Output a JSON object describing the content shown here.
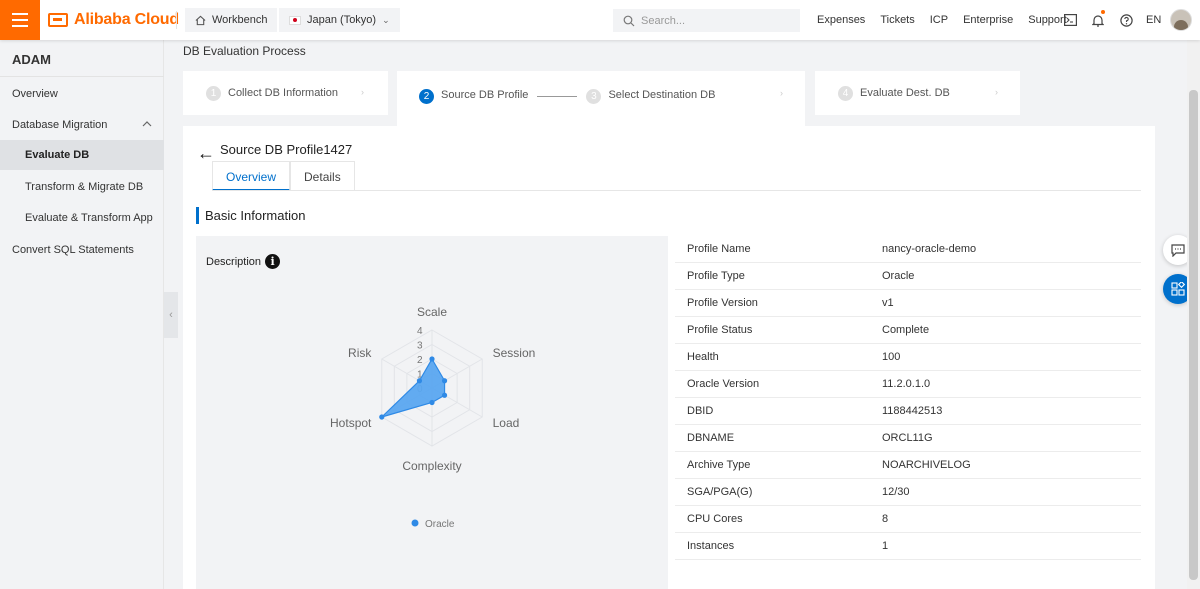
{
  "topbar": {
    "logo_text": "Alibaba Cloud",
    "workbench_label": "Workbench",
    "region_label": "Japan (Tokyo)",
    "search_placeholder": "Search...",
    "links": [
      "Expenses",
      "Tickets",
      "ICP",
      "Enterprise",
      "Support"
    ],
    "lang": "EN"
  },
  "sidebar": {
    "title": "ADAM",
    "items": [
      {
        "label": "Overview"
      },
      {
        "label": "Database Migration"
      },
      {
        "label": "Evaluate DB"
      },
      {
        "label": "Transform & Migrate DB"
      },
      {
        "label": "Evaluate & Transform App"
      },
      {
        "label": "Convert SQL Statements"
      }
    ]
  },
  "page": {
    "title": "DB Evaluation Process",
    "steps": [
      {
        "num": "1",
        "label": "Collect DB Information"
      },
      {
        "num": "2",
        "label": "Source DB Profile"
      },
      {
        "num": "3",
        "label": "Select Destination DB"
      },
      {
        "num": "4",
        "label": "Evaluate Dest. DB"
      }
    ],
    "profile_title": "Source DB Profile1427",
    "tabs": [
      "Overview",
      "Details"
    ],
    "section_title": "Basic Information",
    "description_label": "Description"
  },
  "chart_data": {
    "type": "radar",
    "indicators": [
      "Scale",
      "Session",
      "Load",
      "Complexity",
      "Hotspot",
      "Risk"
    ],
    "radial_ticks": [
      "0",
      "1",
      "2",
      "3",
      "4"
    ],
    "max": 4,
    "series": [
      {
        "name": "Oracle",
        "values": [
          2,
          1,
          1,
          1,
          4,
          1
        ]
      }
    ],
    "colors": {
      "line": "#2f8ae6",
      "fill": "#5aa7f0"
    },
    "legend_position": "bottom"
  },
  "info_table": [
    {
      "key": "Profile Name",
      "value": "nancy-oracle-demo"
    },
    {
      "key": "Profile Type",
      "value": "Oracle"
    },
    {
      "key": "Profile Version",
      "value": "v1"
    },
    {
      "key": "Profile Status",
      "value": "Complete"
    },
    {
      "key": "Health",
      "value": "100"
    },
    {
      "key": "Oracle Version",
      "value": "11.2.0.1.0"
    },
    {
      "key": "DBID",
      "value": "1188442513"
    },
    {
      "key": "DBNAME",
      "value": "ORCL11G"
    },
    {
      "key": "Archive Type",
      "value": "NOARCHIVELOG"
    },
    {
      "key": "SGA/PGA(G)",
      "value": "12/30"
    },
    {
      "key": "CPU Cores",
      "value": "8"
    },
    {
      "key": "Instances",
      "value": "1"
    }
  ],
  "colors": {
    "brand": "#ff6a00",
    "accent": "#0070cc"
  }
}
